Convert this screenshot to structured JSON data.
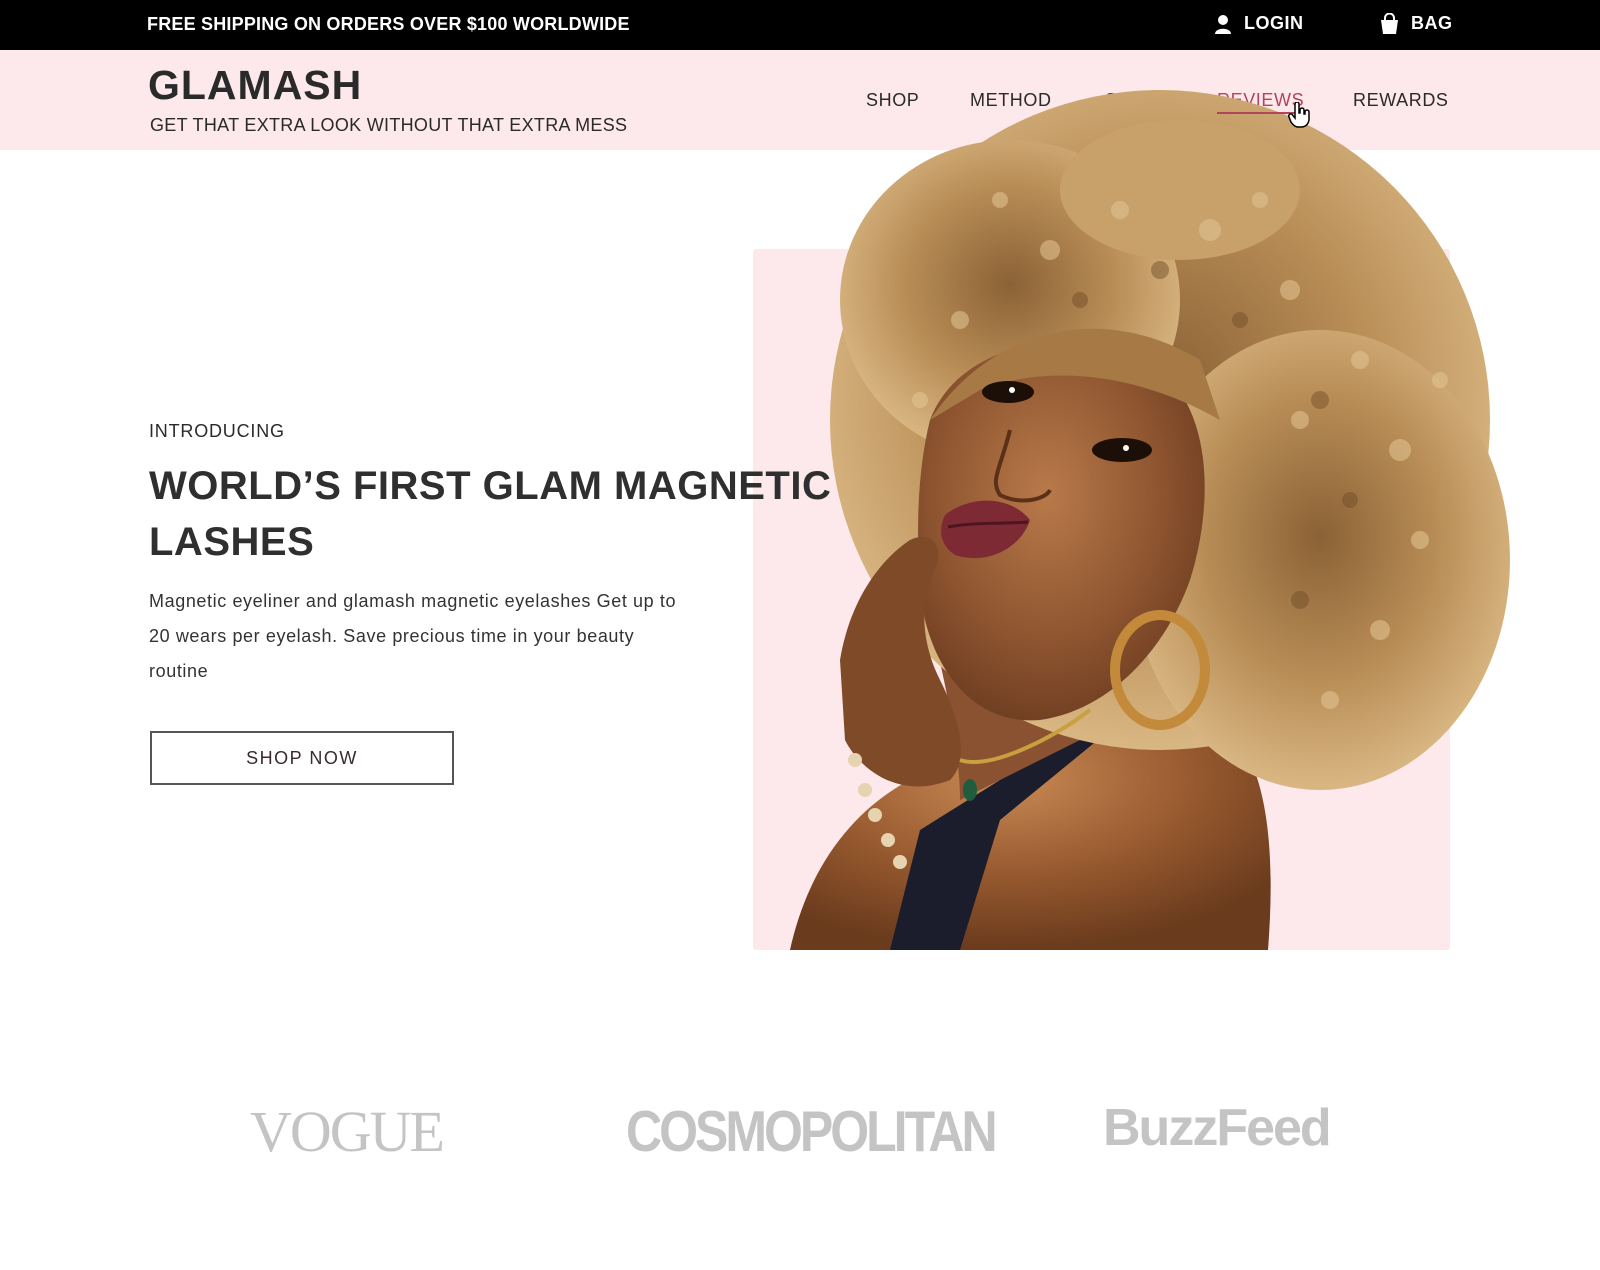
{
  "topbar": {
    "promo": "FREE SHIPPING ON ORDERS OVER $100 WORLDWIDE",
    "login_label": "LOGIN",
    "login_icon": "user-icon",
    "bag_label": "BAG",
    "bag_icon": "shopping-bag-icon"
  },
  "header": {
    "logo": "GLAMASH",
    "tagline": "GET THAT EXTRA LOOK WITHOUT THAT EXTRA MESS",
    "nav": [
      {
        "label": "SHOP"
      },
      {
        "label": "METHOD"
      },
      {
        "label": "STORY"
      },
      {
        "label": "REVIEWS",
        "active": true
      },
      {
        "label": "REWARDS"
      }
    ]
  },
  "hero": {
    "eyebrow": "INTRODUCING",
    "headline": "WORLD’S FIRST GLAM MAGNETIC LASHES",
    "description": "Magnetic eyeliner and glamash magnetic eyelashes Get up to 20 wears per eyelash. Save precious time in your beauty routine",
    "cta_label": "SHOP NOW"
  },
  "press": {
    "logos": [
      "VOGUE",
      "COSMOPOLITAN",
      "BuzzFeed"
    ]
  },
  "colors": {
    "topbar_bg": "#000000",
    "header_bg": "#fde8ec",
    "accent": "#b0465a",
    "press_gray": "#c4c4c4"
  }
}
